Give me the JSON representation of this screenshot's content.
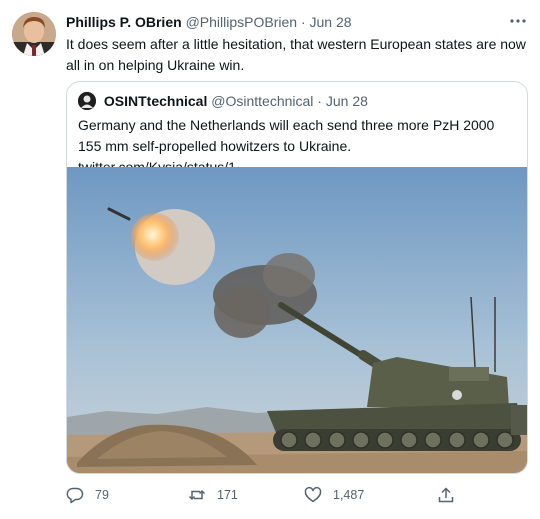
{
  "tweet": {
    "author_name": "Phillips P. OBrien",
    "author_handle": "@PhillipsPOBrien",
    "separator": "·",
    "date": "Jun 28",
    "text": "It does seem after a little hesitation, that western European states are now all in on helping Ukraine win."
  },
  "quoted_tweet": {
    "author_name": "OSINTtechnical",
    "author_handle": "@Osinttechnical",
    "separator": "·",
    "date": "Jun 28",
    "text": "Germany and the Netherlands will each send three more PzH 2000 155 mm self-propelled howitzers to Ukraine.  twitter.com/Kysia/status/1..."
  },
  "actions": {
    "reply_count": "79",
    "retweet_count": "171",
    "like_count": "1,487"
  },
  "icons": {
    "more": "more-horizontal-icon",
    "reply": "reply-icon",
    "retweet": "retweet-icon",
    "like": "heart-icon",
    "share": "share-icon"
  },
  "colors": {
    "text": "#0f1419",
    "secondary": "#536471",
    "border": "#cfd9de"
  }
}
